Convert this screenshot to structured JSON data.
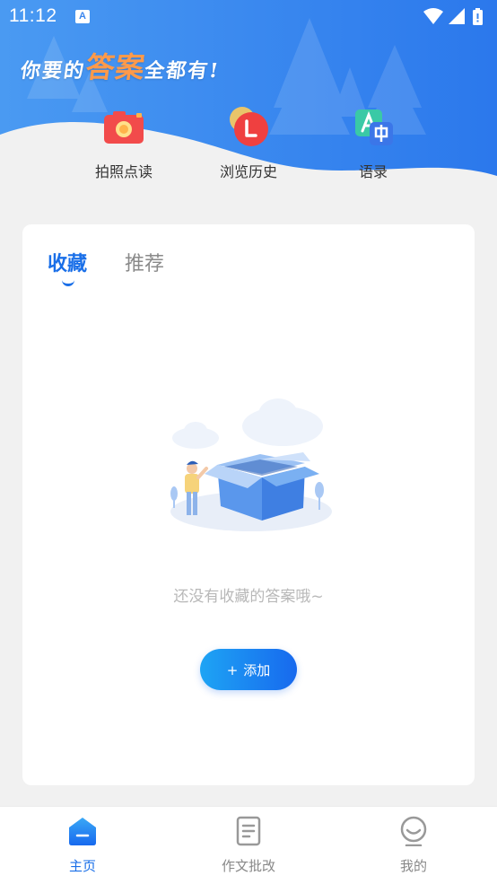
{
  "status_bar": {
    "time": "11:12",
    "notification_icon": "A"
  },
  "header": {
    "slogan_before": "你要的",
    "slogan_highlight": "答案",
    "slogan_after": "全都有!",
    "brand_color": "#3a86ee"
  },
  "quick_actions": [
    {
      "label": "拍照点读",
      "icon": "camera-icon"
    },
    {
      "label": "浏览历史",
      "icon": "history-icon"
    },
    {
      "label": "语录",
      "icon": "translate-icon"
    }
  ],
  "tabs": [
    {
      "label": "收藏",
      "active": true
    },
    {
      "label": "推荐",
      "active": false
    }
  ],
  "empty_state": {
    "message": "还没有收藏的答案哦~",
    "illustration": "open-box-illustration"
  },
  "add_button": {
    "plus": "+",
    "label": "添加"
  },
  "bottom_nav": [
    {
      "label": "主页",
      "icon": "home-icon",
      "active": true
    },
    {
      "label": "作文批改",
      "icon": "document-icon",
      "active": false
    },
    {
      "label": "我的",
      "icon": "profile-icon",
      "active": false
    }
  ],
  "colors": {
    "accent": "#1a6fe8",
    "button_start": "#1ea4f4",
    "button_end": "#1769ee"
  }
}
